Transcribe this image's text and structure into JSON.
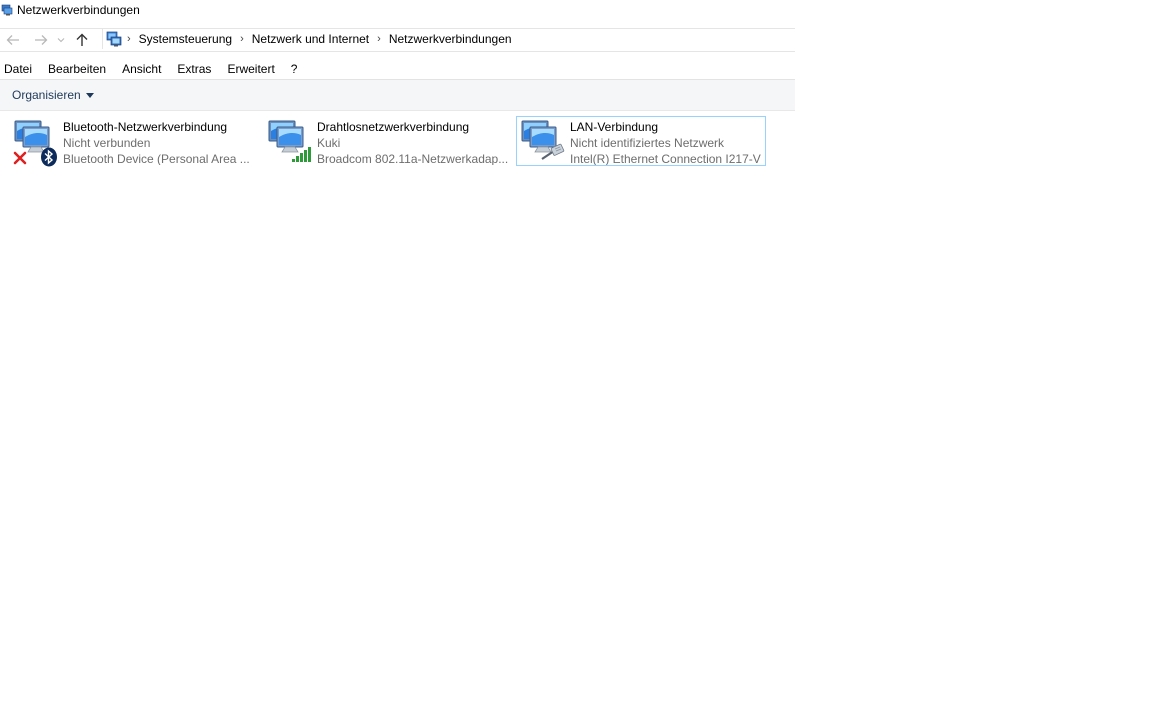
{
  "window": {
    "title": "Netzwerkverbindungen"
  },
  "address": {
    "crumbs": [
      "Systemsteuerung",
      "Netzwerk und Internet",
      "Netzwerkverbindungen"
    ]
  },
  "menu": {
    "items": [
      "Datei",
      "Bearbeiten",
      "Ansicht",
      "Extras",
      "Erweitert",
      "?"
    ]
  },
  "toolbar": {
    "organize_label": "Organisieren"
  },
  "connections": [
    {
      "name": "Bluetooth-Netzwerkverbindung",
      "status": "Nicht verbunden",
      "device": "Bluetooth Device (Personal Area ...",
      "overlay_icon": "bluetooth-disconnected-icon"
    },
    {
      "name": "Drahtlosnetzwerkverbindung",
      "status": "Kuki",
      "device": "Broadcom 802.11a-Netzwerkadap...",
      "overlay_icon": "wifi-signal-icon"
    },
    {
      "name": "LAN-Verbindung",
      "status": "Nicht identifiziertes Netzwerk",
      "device": "Intel(R) Ethernet Connection I217-V",
      "overlay_icon": "ethernet-cable-icon",
      "selected": true
    }
  ],
  "colors": {
    "selection_border": "#99d1ff",
    "command_bar_bg": "#f5f6f7",
    "organize_text": "#1e395b",
    "secondary_text": "#6d6d6d"
  }
}
